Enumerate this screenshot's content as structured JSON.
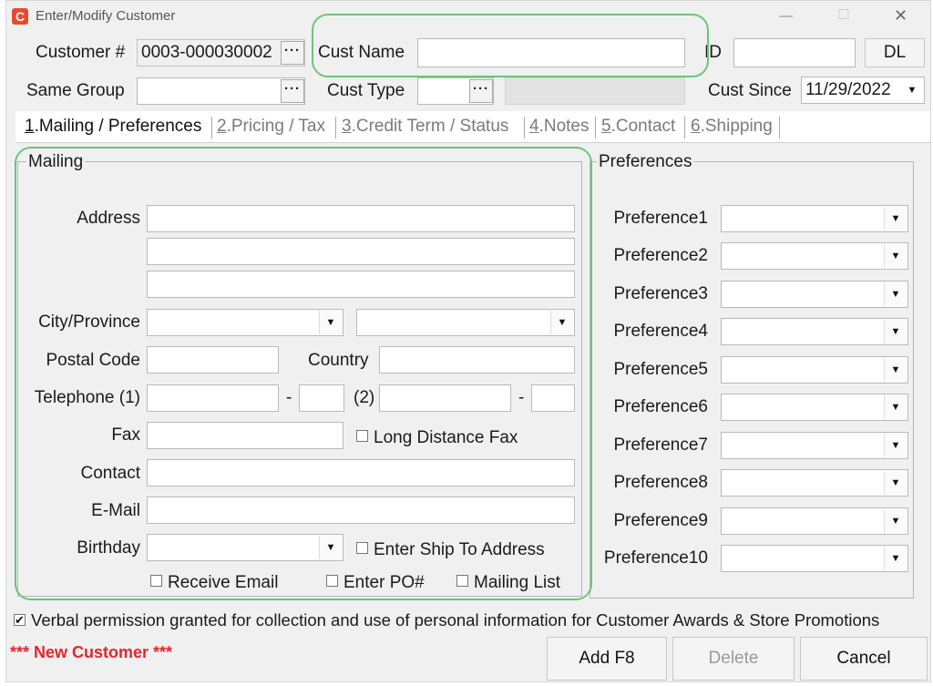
{
  "window": {
    "title": "Enter/Modify Customer",
    "minimize": "—",
    "maximize": "☐",
    "close": "✕",
    "icon_letter": "C"
  },
  "header": {
    "customer_label": "Customer #",
    "customer_value": "0003-000030002",
    "custname_label": "Cust Name",
    "custname_value": "",
    "id_label": "ID",
    "id_value": "",
    "dl_button": "DL",
    "samegroup_label": "Same Group",
    "samegroup_value": "",
    "custtype_label": "Cust Type",
    "custtype_value": "",
    "custsince_label": "Cust Since",
    "custsince_value": "11/29/2022",
    "ellipsis": "···"
  },
  "tabs": [
    {
      "num": "1",
      "label": ".Mailing / Preferences"
    },
    {
      "num": "2",
      "label": ".Pricing / Tax"
    },
    {
      "num": "3",
      "label": ".Credit Term / Status"
    },
    {
      "num": "4",
      "label": ".Notes"
    },
    {
      "num": "5",
      "label": ".Contact"
    },
    {
      "num": "6",
      "label": ".Shipping"
    }
  ],
  "mailing": {
    "title": "Mailing",
    "address_label": "Address",
    "city_label": "City/Province",
    "postal_label": "Postal Code",
    "country_label": "Country",
    "telephone_label": "Telephone (1)",
    "dash": "-",
    "tel2_label": "(2)",
    "fax_label": "Fax",
    "long_distance_fax": "Long Distance Fax",
    "contact_label": "Contact",
    "email_label": "E-Mail",
    "birthday_label": "Birthday",
    "enter_ship_to": "Enter Ship To Address",
    "receive_email": "Receive Email",
    "enter_po": "Enter PO#",
    "mailing_list": "Mailing List"
  },
  "preferences": {
    "title": "Preferences",
    "items": [
      "Preference1",
      "Preference2",
      "Preference3",
      "Preference4",
      "Preference5",
      "Preference6",
      "Preference7",
      "Preference8",
      "Preference9",
      "Preference10"
    ]
  },
  "footer": {
    "verbal_permission": "Verbal permission granted for collection and use of personal information for Customer Awards & Store Promotions",
    "verbal_checked": true,
    "status": "*** New Customer ***",
    "add_button": "Add F8",
    "delete_button": "Delete",
    "cancel_button": "Cancel"
  },
  "icons": {
    "dropdown": "▼",
    "check": "✔"
  },
  "colors": {
    "status_red": "#e8262a",
    "highlight_green": "#6cc47c",
    "app_icon_red": "#e84a2f"
  }
}
